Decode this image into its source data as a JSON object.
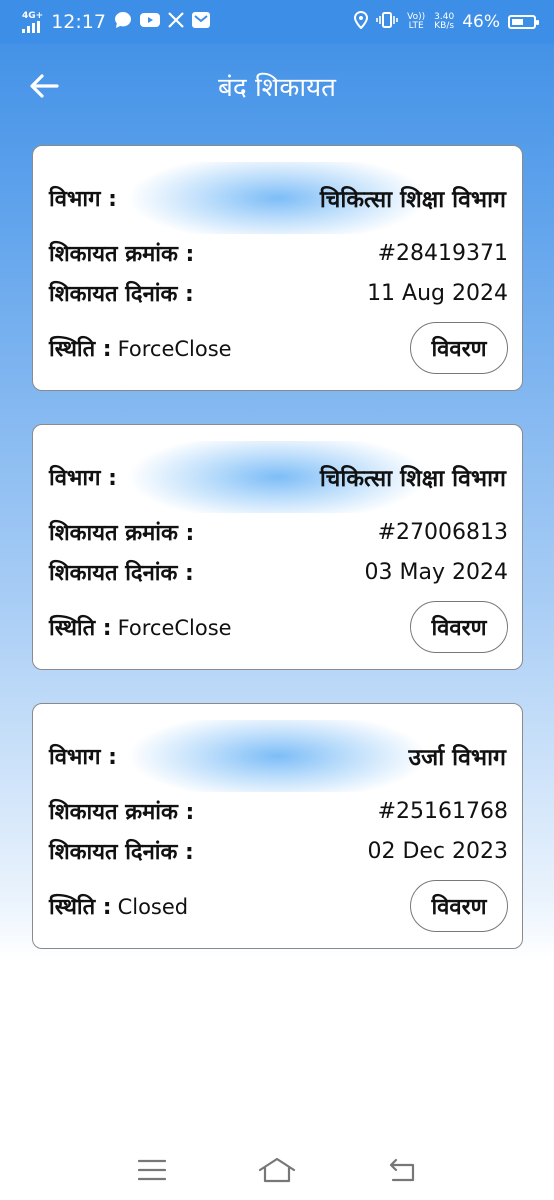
{
  "status_bar": {
    "network": "4G+",
    "time": "12:17",
    "lte_label": "Vo)) LTE",
    "speed_value": "3.40",
    "speed_unit": "KB/s",
    "battery": "46%"
  },
  "header": {
    "title": "बंद शिकायत"
  },
  "labels": {
    "department": "विभाग :",
    "complaint_number": "शिकायत क्रमांक :",
    "complaint_date": "शिकायत दिनांक :",
    "status": "स्थिति :",
    "details_button": "विवरण"
  },
  "complaints": [
    {
      "department": "चिकित्सा शिक्षा विभाग",
      "number": "#28419371",
      "date": "11 Aug 2024",
      "status": "ForceClose"
    },
    {
      "department": "चिकित्सा शिक्षा विभाग",
      "number": "#27006813",
      "date": "03 May 2024",
      "status": "ForceClose"
    },
    {
      "department": "उर्जा विभाग",
      "number": "#25161768",
      "date": "02 Dec 2023",
      "status": "Closed"
    }
  ],
  "colors": {
    "header_blue": "#3c8ee6",
    "card_border": "#8a8a8a",
    "highlight_blue": "#7dbdf7"
  }
}
